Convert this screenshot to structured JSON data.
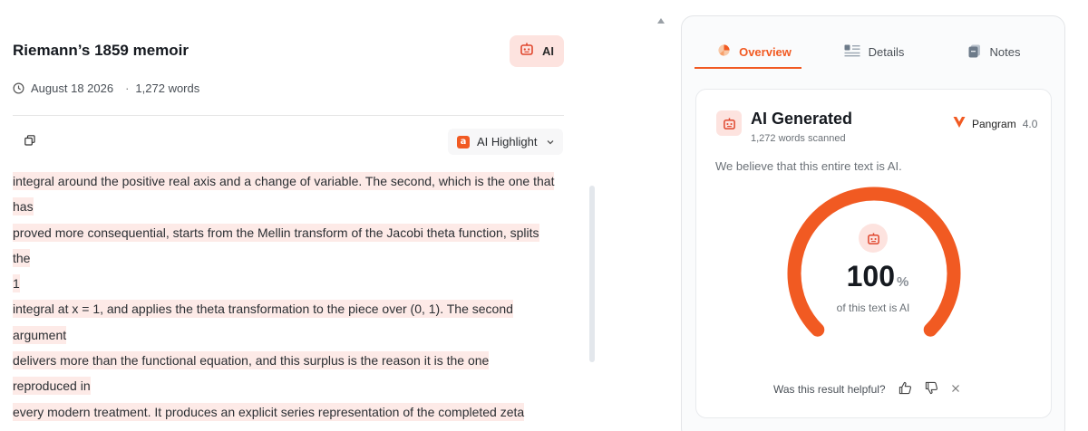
{
  "document": {
    "title": "Riemann’s 1859 memoir",
    "ai_badge_label": "AI",
    "date": "August 18 2026",
    "separator": "·",
    "word_count": "1,272 words",
    "highlight_select": {
      "icon_letter": "a",
      "label": "AI Highlight"
    },
    "lines": [
      "integral around the positive real axis and a change of variable. The second, which is the one that",
      "has",
      "proved more consequential, starts from the Mellin transform of the Jacobi theta function, splits",
      "the",
      "1",
      "integral at x = 1, and applies the theta transformation to the piece over (0, 1). The second",
      "argument",
      "delivers more than the functional equation, and this surplus is the reason it is the one",
      "reproduced in",
      "every modern treatment. It produces an explicit series representation of the completed zeta"
    ]
  },
  "panel": {
    "tabs": [
      {
        "label": "Overview",
        "icon": "overview-icon",
        "active": true
      },
      {
        "label": "Details",
        "icon": "details-icon",
        "active": false
      },
      {
        "label": "Notes",
        "icon": "notes-icon",
        "active": false
      }
    ],
    "result": {
      "title": "AI Generated",
      "subtitle": "1,272 words scanned",
      "brand": "Pangram",
      "brand_version": "4.0",
      "belief": "We believe that this entire text is AI.",
      "value": "100",
      "value_unit": "%",
      "value_fraction": 1.0,
      "value_label": "of this text is AI",
      "feedback_question": "Was this result helpful?"
    },
    "colors": {
      "accent": "#f15a22",
      "highlight": "#fdeae7",
      "badge_bg": "#fde3df"
    }
  }
}
